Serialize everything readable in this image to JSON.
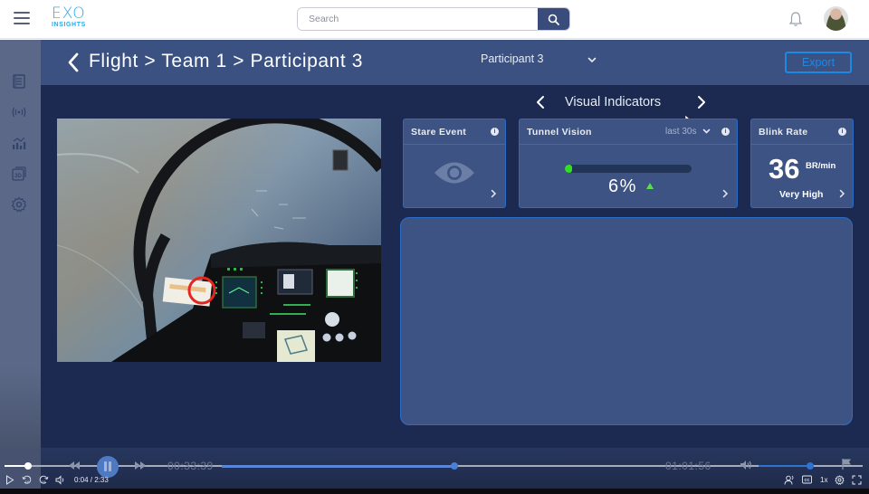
{
  "topbar": {
    "logo_main": "EXO",
    "logo_sub": "INSIGHTS",
    "search_placeholder": "Search",
    "search_value": ""
  },
  "sidebar": {
    "items": [
      {
        "icon": "report-icon",
        "label": "Reports"
      },
      {
        "icon": "broadcast-icon",
        "label": "Live"
      },
      {
        "icon": "analytics-icon",
        "label": "Analytics"
      },
      {
        "icon": "3d-icon",
        "label": "3D"
      },
      {
        "icon": "gear-icon",
        "label": "Settings"
      }
    ]
  },
  "header": {
    "breadcrumb": [
      "Flight",
      "Team 1",
      "Participant 3"
    ],
    "separator": ">",
    "participant_selected": "Participant 3",
    "export_label": "Export"
  },
  "main": {
    "section_title": "Visual Indicators",
    "cards": {
      "stare_event": {
        "title": "Stare Event"
      },
      "tunnel_vision": {
        "title": "Tunnel Vision",
        "range": "last 30s",
        "value_text": "6%",
        "value_percent": 6,
        "trend": "up",
        "accent": "#32e022"
      },
      "blink_rate": {
        "title": "Blink Rate",
        "value": "36",
        "unit": "BR/min",
        "level": "Very High"
      }
    }
  },
  "player": {
    "current_time": "00:33:39",
    "end_time": "01:01:56",
    "readout": "0:04 / 2:33",
    "speed": "1x",
    "played_fraction": 0.027,
    "inner_fraction": 0.5,
    "volume_fraction": 0.9
  },
  "colors": {
    "brand": "#2fa8e6",
    "header_bg": "#3b5182",
    "main_bg": "#1c2a52",
    "card_bg": "#3d5384",
    "card_border": "#2e6dc7",
    "export": "#1e88e5"
  }
}
